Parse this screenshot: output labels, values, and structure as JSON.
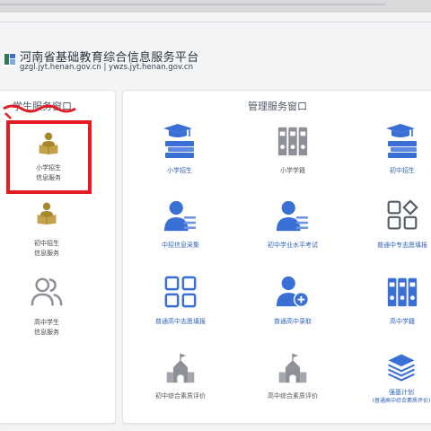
{
  "colors": {
    "accent_blue": "#3a6fd6",
    "icon_gray": "#8e9098",
    "icon_gold": "#a8862a",
    "highlight_red": "#e31b23",
    "text_blue": "#2f63b8"
  },
  "header": {
    "title": "河南省基础教育综合信息服务平台",
    "urls": "gzgl.jyt.henan.gov.cn | ywzs.jyt.henan.gov.cn",
    "logo_icon": "platform-logo-icon"
  },
  "student_window": {
    "title": "学生服务窗口",
    "items": [
      {
        "line1": "小学招生",
        "line2": "信息服务",
        "icon": "student-reading-icon"
      },
      {
        "line1": "初中招生",
        "line2": "信息服务",
        "icon": "student-reading-icon"
      },
      {
        "line1": "高中学生",
        "line2": "信息服务",
        "icon": "users-outline-icon"
      }
    ]
  },
  "admin_window": {
    "title": "管理服务窗口",
    "items": [
      {
        "label": "小学招生",
        "icon": "graduation-books-icon"
      },
      {
        "label": "小学学籍",
        "icon": "binders-icon"
      },
      {
        "label": "初中招生",
        "icon": "graduation-books-icon"
      },
      {
        "label": "中招信息采集",
        "icon": "user-list-icon"
      },
      {
        "label": "初中学业水平考试",
        "icon": "user-list-icon"
      },
      {
        "label": "普通中专志愿填报",
        "icon": "grid-diamond-icon"
      },
      {
        "label": "普通高中志愿填报",
        "icon": "grid-squares-icon"
      },
      {
        "label": "普通高中录取",
        "icon": "user-add-icon"
      },
      {
        "label": "高中学籍",
        "icon": "binders-icon"
      },
      {
        "label": "初中综合素质评价",
        "icon": "school-building-icon"
      },
      {
        "label": "高中综合素质评价",
        "icon": "school-building-icon"
      },
      {
        "label": "强基计划",
        "sublabel": "(普通高中综合素质评价)",
        "icon": "layers-stack-icon"
      }
    ]
  }
}
